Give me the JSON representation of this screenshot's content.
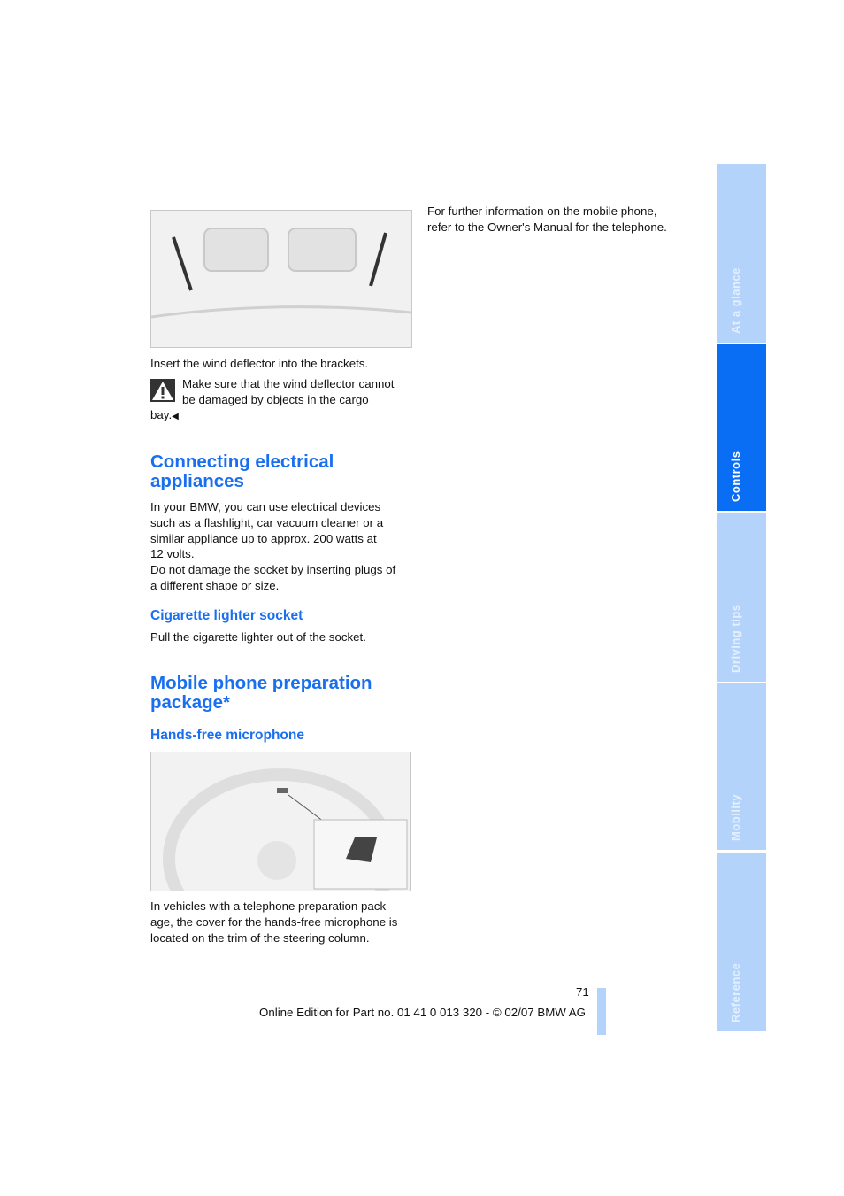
{
  "left": {
    "fig1_caption": "Insert the wind deflector into the brackets.",
    "warning_text_line1": "Make sure that the wind deflector cannot",
    "warning_text_line2": "be damaged by objects in the cargo",
    "warning_text_line3": "bay.",
    "end_mark": "◀",
    "section1_title": "Connecting electrical appliances",
    "section1_body": [
      "In your BMW, you can use electrical devices",
      "such as a flashlight, car vacuum cleaner or a",
      "similar appliance up to approx. 200 watts at",
      "12 volts.",
      "Do not damage the socket by inserting plugs of",
      "a different shape or size."
    ],
    "sub1_title": "Cigarette lighter socket",
    "sub1_body": "Pull the cigarette lighter out of the socket.",
    "section2_title_line1": "Mobile phone preparation",
    "section2_title_line2": "package*",
    "sub2_title": "Hands-free microphone",
    "fig2_caption": [
      "In vehicles with a telephone preparation pack-",
      "age, the cover for the hands-free microphone is",
      "located on the trim of the steering column."
    ]
  },
  "right": {
    "body": [
      "For further information on the mobile phone,",
      "refer to the Owner's Manual for the telephone."
    ]
  },
  "footer": {
    "page_number": "71",
    "edition": "Online Edition for Part no. 01 41 0 013 320 - © 02/07 BMW AG"
  },
  "tabs": [
    {
      "label": "At a glance"
    },
    {
      "label": "Controls",
      "active": true
    },
    {
      "label": "Driving tips"
    },
    {
      "label": "Mobility"
    },
    {
      "label": "Reference"
    }
  ],
  "colors": {
    "accent": "#1a6ff0",
    "tab_active": "#0a6ef5",
    "tab_inactive": "#b3d3fb"
  }
}
